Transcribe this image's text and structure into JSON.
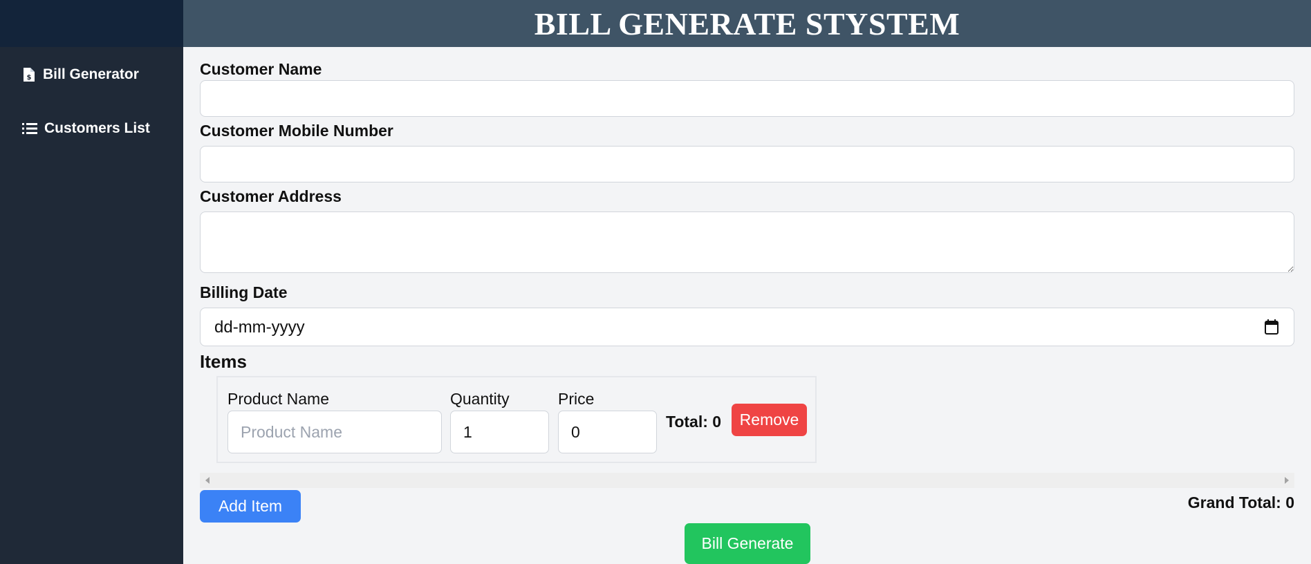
{
  "header": {
    "title": "BILL GENERATE STYSTEM"
  },
  "sidebar": {
    "items": [
      {
        "label": "Bill Generator",
        "icon": "file-invoice-dollar-icon"
      },
      {
        "label": "Customers List",
        "icon": "list-icon"
      }
    ]
  },
  "form": {
    "customer_name_label": "Customer Name",
    "customer_name_value": "",
    "mobile_label": "Customer Mobile Number",
    "mobile_value": "",
    "address_label": "Customer Address",
    "address_value": "",
    "date_label": "Billing Date",
    "date_value": "dd-mm-yyyy"
  },
  "items": {
    "title": "Items",
    "rows": [
      {
        "product_label": "Product Name",
        "product_placeholder": "Product Name",
        "quantity_label": "Quantity",
        "quantity_value": "1",
        "price_label": "Price",
        "price_value": "0",
        "total_text": "Total: 0",
        "remove_label": "Remove"
      }
    ]
  },
  "actions": {
    "add_item_label": "Add Item",
    "grand_total_text": "Grand Total: 0",
    "bill_generate_label": "Bill Generate"
  },
  "colors": {
    "sidebar": "#1f2937",
    "header": "#3f5466",
    "remove": "#ef4444",
    "add_item": "#3b82f6",
    "generate": "#22c55e"
  }
}
